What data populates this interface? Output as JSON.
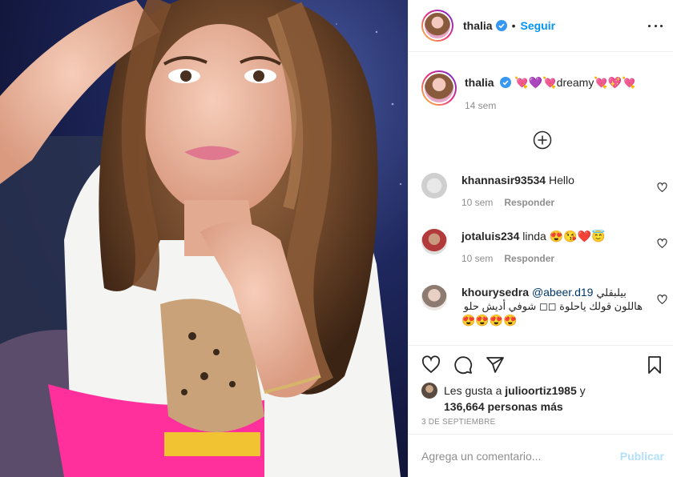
{
  "header": {
    "username": "thalia",
    "separator": "•",
    "follow_label": "Seguir"
  },
  "caption": {
    "username": "thalia",
    "text": "💘💜💘dreamy💘💖💘",
    "time": "14 sem"
  },
  "comments": [
    {
      "username": "khannasir93534",
      "text": "Hello",
      "time": "10 sem",
      "reply_label": "Responder"
    },
    {
      "username": "jotaluis234",
      "text": "linda",
      "emojis": "😍😘❤️😇",
      "time": "10 sem",
      "reply_label": "Responder"
    },
    {
      "username": "khourysedra",
      "mention": "@abeer.d19",
      "arabic_line1": "بيلبقلي",
      "arabic_line2": "هاللون قولك ياحلوة ◻◻ شوفي أديش حلو",
      "emojis_line3": "😍😍😍😍"
    }
  ],
  "likes": {
    "prefix": "Les gusta a",
    "user": "julioortiz1985",
    "joiner": "y",
    "count": "136,664 personas más"
  },
  "date": "3 DE SEPTIEMBRE",
  "add_comment": {
    "placeholder": "Agrega un comentario...",
    "publish_label": "Publicar"
  },
  "colors": {
    "accent": "#0095f6",
    "publish_disabled": "#b2dffc",
    "muted": "#8e8e8e",
    "text": "#262626",
    "border": "#efefef"
  }
}
